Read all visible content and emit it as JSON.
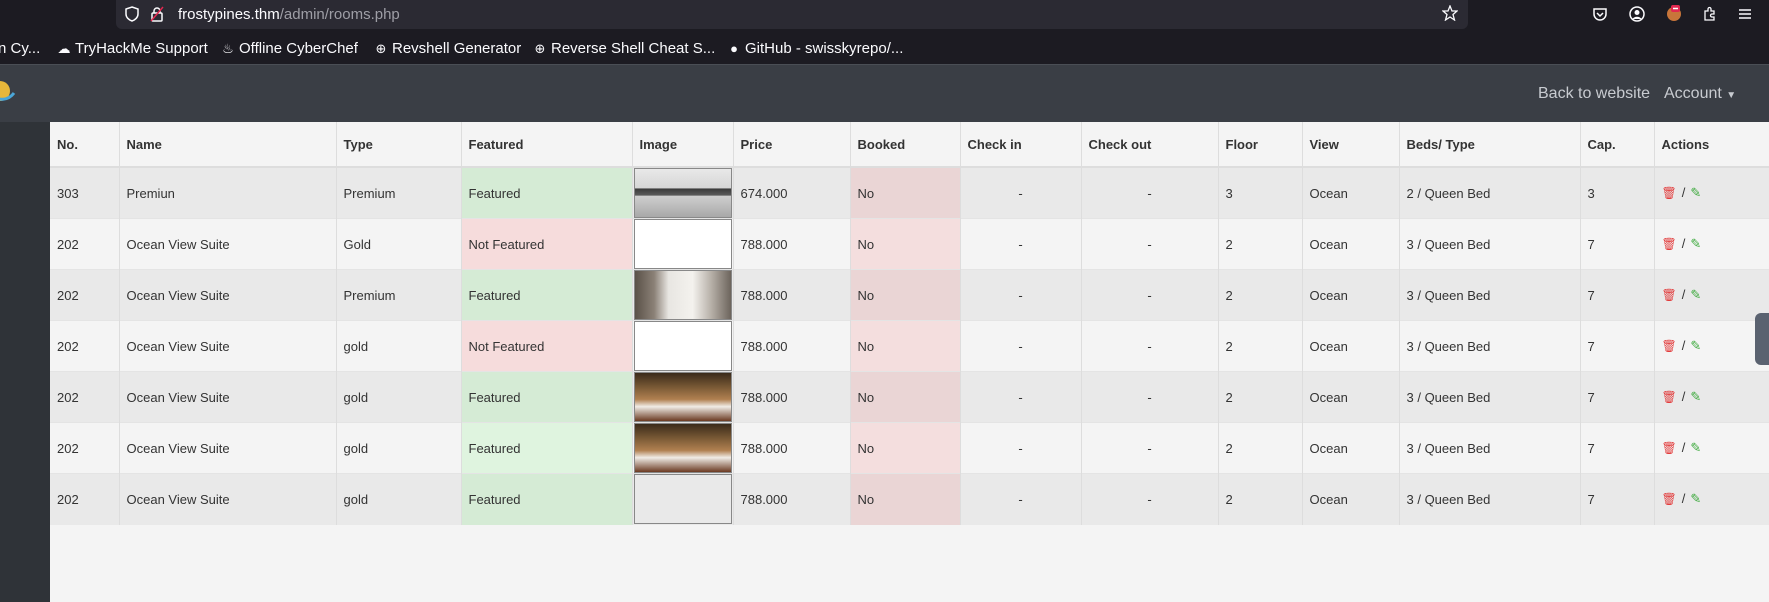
{
  "browser": {
    "url_host": "frostypines.thm",
    "url_path": "/admin/rooms.php",
    "bookmarks": [
      {
        "label": "n Cy...",
        "icon": "cyberchef-icon"
      },
      {
        "label": "TryHackMe Support",
        "icon": "tryhackme-icon"
      },
      {
        "label": "Offline CyberChef",
        "icon": "chef-hat-icon"
      },
      {
        "label": "Revshell Generator",
        "icon": "globe-icon"
      },
      {
        "label": "Reverse Shell Cheat S...",
        "icon": "globe-icon"
      },
      {
        "label": "GitHub - swisskyrepo/...",
        "icon": "github-icon"
      }
    ]
  },
  "header": {
    "back_link": "Back to website",
    "account_label": "Account"
  },
  "table": {
    "columns": [
      "No.",
      "Name",
      "Type",
      "Featured",
      "Image",
      "Price",
      "Booked",
      "Check in",
      "Check out",
      "Floor",
      "View",
      "Beds/ Type",
      "Cap.",
      "Actions"
    ],
    "rows": [
      {
        "no": "303",
        "name": "Premiun",
        "type": "Premium",
        "featured": "Featured",
        "image": "living-room",
        "price": "674.000",
        "booked": "No",
        "check_in": "-",
        "check_out": "-",
        "floor": "3",
        "view": "Ocean",
        "beds": "2 / Queen Bed",
        "cap": "3"
      },
      {
        "no": "202",
        "name": "Ocean View Suite",
        "type": "Gold",
        "featured": "Not Featured",
        "image": "none",
        "price": "788.000",
        "booked": "No",
        "check_in": "-",
        "check_out": "-",
        "floor": "2",
        "view": "Ocean",
        "beds": "3 / Queen Bed",
        "cap": "7"
      },
      {
        "no": "202",
        "name": "Ocean View Suite",
        "type": "Premium",
        "featured": "Featured",
        "image": "bathroom",
        "price": "788.000",
        "booked": "No",
        "check_in": "-",
        "check_out": "-",
        "floor": "2",
        "view": "Ocean",
        "beds": "3 / Queen Bed",
        "cap": "7"
      },
      {
        "no": "202",
        "name": "Ocean View Suite",
        "type": "gold",
        "featured": "Not Featured",
        "image": "none",
        "price": "788.000",
        "booked": "No",
        "check_in": "-",
        "check_out": "-",
        "floor": "2",
        "view": "Ocean",
        "beds": "3 / Queen Bed",
        "cap": "7"
      },
      {
        "no": "202",
        "name": "Ocean View Suite",
        "type": "gold",
        "featured": "Featured",
        "image": "hotel-room",
        "price": "788.000",
        "booked": "No",
        "check_in": "-",
        "check_out": "-",
        "floor": "2",
        "view": "Ocean",
        "beds": "3 / Queen Bed",
        "cap": "7"
      },
      {
        "no": "202",
        "name": "Ocean View Suite",
        "type": "gold",
        "featured": "Featured",
        "image": "hotel-room",
        "price": "788.000",
        "booked": "No",
        "check_in": "-",
        "check_out": "-",
        "floor": "2",
        "view": "Ocean",
        "beds": "3 / Queen Bed",
        "cap": "7"
      },
      {
        "no": "202",
        "name": "Ocean View Suite",
        "type": "gold",
        "featured": "Featured",
        "image": "none",
        "price": "788.000",
        "booked": "No",
        "check_in": "-",
        "check_out": "-",
        "floor": "2",
        "view": "Ocean",
        "beds": "3 / Queen Bed",
        "cap": "7"
      }
    ],
    "action_separator": "/"
  },
  "colors": {
    "featured_bg": "#d5ebd5",
    "not_featured_bg": "#f6dcdc",
    "booked_bg": "#ead5d5",
    "delete_icon": "#e23b3b",
    "edit_icon": "#3aa83a"
  }
}
